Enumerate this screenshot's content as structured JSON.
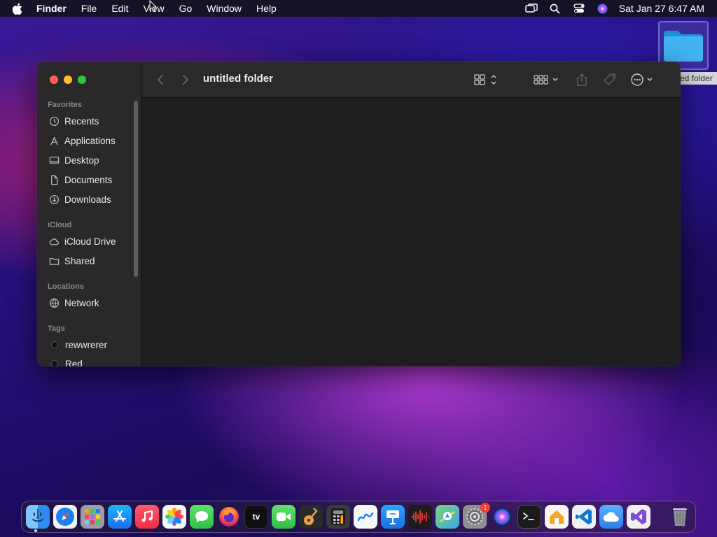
{
  "menubar": {
    "app_name": "Finder",
    "items": [
      "File",
      "Edit",
      "View",
      "Go",
      "Window",
      "Help"
    ],
    "clock": "Sat Jan 27  6:47 AM",
    "tray_icons": [
      "screen-mirroring-icon",
      "spotlight-search-icon",
      "control-center-icon",
      "siri-icon"
    ]
  },
  "desktop": {
    "folder_label": "ed folder"
  },
  "window": {
    "title": "untitled folder",
    "sidebar": {
      "favorites_label": "Favorites",
      "favorites": [
        {
          "label": "Recents",
          "icon": "clock-icon"
        },
        {
          "label": "Applications",
          "icon": "applications-icon"
        },
        {
          "label": "Desktop",
          "icon": "desktop-icon"
        },
        {
          "label": "Documents",
          "icon": "document-icon"
        },
        {
          "label": "Downloads",
          "icon": "download-icon"
        }
      ],
      "icloud_label": "iCloud",
      "icloud": [
        {
          "label": "iCloud Drive",
          "icon": "cloud-icon"
        },
        {
          "label": "Shared",
          "icon": "shared-folder-icon"
        }
      ],
      "locations_label": "Locations",
      "locations": [
        {
          "label": "Network",
          "icon": "network-icon"
        }
      ],
      "tags_label": "Tags",
      "tags": [
        {
          "label": "rewwrerer",
          "color": "#111111"
        },
        {
          "label": "Red",
          "color": "#111111"
        }
      ]
    },
    "toolbar_icons": [
      "back-icon",
      "forward-icon",
      "icon-view-icon",
      "group-icon",
      "share-icon",
      "tag-icon",
      "more-icon",
      "search-icon"
    ]
  },
  "dock": {
    "apps": [
      {
        "name": "Finder",
        "color": "#3b8ef0"
      },
      {
        "name": "Safari",
        "color": "#1e7ff0"
      },
      {
        "name": "Launchpad",
        "color": "#8a8a8a"
      },
      {
        "name": "App Store",
        "color": "#1c8cf5"
      },
      {
        "name": "Music",
        "color": "#fa2d48"
      },
      {
        "name": "Photos",
        "color": "#f0f0f0"
      },
      {
        "name": "Messages",
        "color": "#34c759"
      },
      {
        "name": "Firefox",
        "color": "#ff7139"
      },
      {
        "name": "TV",
        "color": "#111111"
      },
      {
        "name": "FaceTime",
        "color": "#30c75a"
      },
      {
        "name": "GarageBand",
        "color": "#2a2a2a"
      },
      {
        "name": "Calculator",
        "color": "#3a3a3a"
      },
      {
        "name": "Freeform",
        "color": "#f4f4f4"
      },
      {
        "name": "Keynote",
        "color": "#1b86e8"
      },
      {
        "name": "Voice Memos",
        "color": "#1c1c1e"
      },
      {
        "name": "Maps",
        "color": "#5bc06a"
      },
      {
        "name": "System Settings",
        "color": "#8e8e93"
      },
      {
        "name": "Siri",
        "color": "#2a2a60"
      },
      {
        "name": "Terminal",
        "color": "#1a1a1a"
      },
      {
        "name": "Home",
        "color": "#f5a623"
      },
      {
        "name": "Visual Studio Code",
        "color": "#0a65b8"
      },
      {
        "name": "iCloud",
        "color": "#3a93ef"
      },
      {
        "name": "Visual Studio",
        "color": "#6b3fc4"
      },
      {
        "name": "Trash",
        "color": "#6e6e73"
      }
    ],
    "settings_badge": "1",
    "tv_label": "tv"
  }
}
